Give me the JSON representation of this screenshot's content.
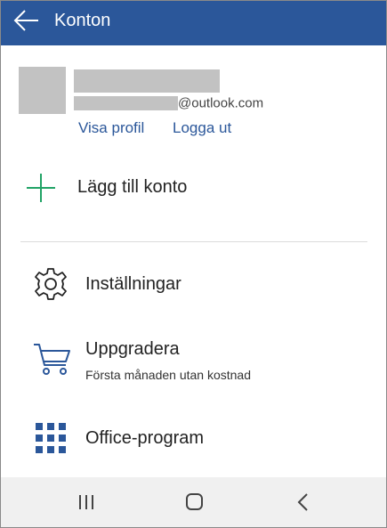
{
  "appbar": {
    "title": "Konton",
    "color": "#2b579a"
  },
  "account": {
    "email_domain": "@outlook.com",
    "view_profile_label": "Visa profil",
    "sign_out_label": "Logga ut"
  },
  "menu": {
    "add_account_label": "Lägg till konto",
    "settings_label": "Inställningar",
    "upgrade_label": "Uppgradera",
    "upgrade_sub": "Första månaden utan kostnad",
    "office_apps_label": "Office-program"
  },
  "icons": {
    "back": "arrow-left-icon",
    "add": "plus-icon",
    "settings": "gear-icon",
    "upgrade": "cart-icon",
    "apps": "grid-icon",
    "nav_recents": "recents-icon",
    "nav_home": "home-icon",
    "nav_back": "chevron-left-icon"
  },
  "colors": {
    "accent": "#2b579a",
    "add_icon": "#21a366",
    "placeholder": "#c2c2c2",
    "navbar": "#f0f0f0"
  }
}
